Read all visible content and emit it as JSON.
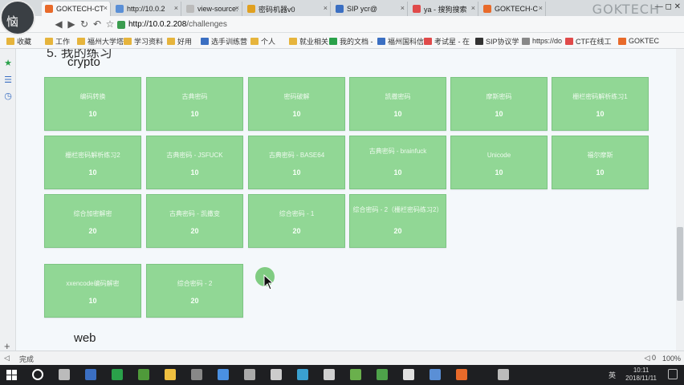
{
  "browser": {
    "avatar_text": "恼",
    "watermark": "GOKTECH",
    "window_controls": "— ◻ ✕",
    "tabs": [
      {
        "label": "GOKTECH-CT",
        "color": "#e86a2a",
        "active": true
      },
      {
        "label": "http://10.0.2",
        "color": "#5a8fd6",
        "active": false
      },
      {
        "label": "view-source:",
        "color": "#bbbbbb",
        "active": false
      },
      {
        "label": "密码机器v0",
        "color": "#e0a020",
        "active": false
      },
      {
        "label": "SIP ycr@",
        "color": "#3b6fc2",
        "active": false
      },
      {
        "label": "ya - 搜狗搜索",
        "color": "#e04a4a",
        "active": false
      },
      {
        "label": "GOKTECH-C",
        "color": "#e86a2a",
        "active": false
      }
    ],
    "url_host": "http://10.0.2.208",
    "url_path": "/challenges",
    "bookmarks": [
      {
        "label": "收藏",
        "color": "#e6b43c"
      },
      {
        "label": "工作",
        "color": "#e6b43c"
      },
      {
        "label": "福州大学塔",
        "color": "#e6b43c"
      },
      {
        "label": "学习资料",
        "color": "#e6b43c"
      },
      {
        "label": "好用",
        "color": "#e6b43c"
      },
      {
        "label": "选手训练营",
        "color": "#3b6fc2"
      },
      {
        "label": "个人",
        "color": "#e6b43c"
      },
      {
        "label": "就业相关",
        "color": "#e6b43c"
      },
      {
        "label": "我的文档 -",
        "color": "#2aa14a"
      },
      {
        "label": "福州国科信",
        "color": "#3b6fc2"
      },
      {
        "label": "考试星 - 在",
        "color": "#e04a4a"
      },
      {
        "label": "SIP协议学",
        "color": "#333333"
      },
      {
        "label": "https://do",
        "color": "#888888"
      },
      {
        "label": "CTF在线工",
        "color": "#e04a4a"
      },
      {
        "label": "GOKTEC",
        "color": "#e86a2a"
      }
    ]
  },
  "page": {
    "cut_heading": "5.  我的练习",
    "sections": [
      {
        "title": "crypto",
        "rows": [
          [
            {
              "name": "编码转换",
              "points": "10"
            },
            {
              "name": "古典密码",
              "points": "10"
            },
            {
              "name": "密码破解",
              "points": "10"
            },
            {
              "name": "凯撒密码",
              "points": "10"
            },
            {
              "name": "摩斯密码",
              "points": "10"
            },
            {
              "name": "栅栏密码解析练习1",
              "points": "10"
            }
          ],
          [
            {
              "name": "栅栏密码解析练习2",
              "points": "10"
            },
            {
              "name": "古典密码 - JSFUCK",
              "points": "10"
            },
            {
              "name": "古典密码 - BASE64",
              "points": "10"
            },
            {
              "name": "古典密码 - brainfuck",
              "points": "10"
            },
            {
              "name": "Unicode",
              "points": "10"
            },
            {
              "name": "福尔摩斯",
              "points": "10"
            }
          ],
          [
            {
              "name": "综合加密解密",
              "points": "20"
            },
            {
              "name": "古典密码 - 凯撒变",
              "points": "20"
            },
            {
              "name": "综合密码 - 1",
              "points": "20"
            },
            {
              "name": "综合密码 - 2（栅栏密码练习2）",
              "points": "20"
            }
          ],
          [
            {
              "name": "xxencode编码解密",
              "points": "10"
            },
            {
              "name": "综合密码 - 2",
              "points": "20"
            }
          ]
        ]
      },
      {
        "title": "web",
        "rows": []
      }
    ]
  },
  "statusbar": {
    "status": "完成",
    "plus": "+",
    "right_items": [
      "◁ 0",
      "100%"
    ]
  },
  "taskbar": {
    "time": "10:11",
    "date": "2018/11/11",
    "ime": "英",
    "icons": [
      "#ffffff",
      "#bbbbbb",
      "#3b6fc2",
      "#2aa14a",
      "#4f9a3a",
      "#f0c040",
      "#888888",
      "#4a90e2",
      "#aaaaaa",
      "#cccccc",
      "#3aa0d0",
      "#d0d0d0",
      "#6ab04c",
      "#4ea24a",
      "#e0e0e0",
      "#5a8fd6",
      "#e86a2a",
      "#bbbbbb"
    ]
  }
}
